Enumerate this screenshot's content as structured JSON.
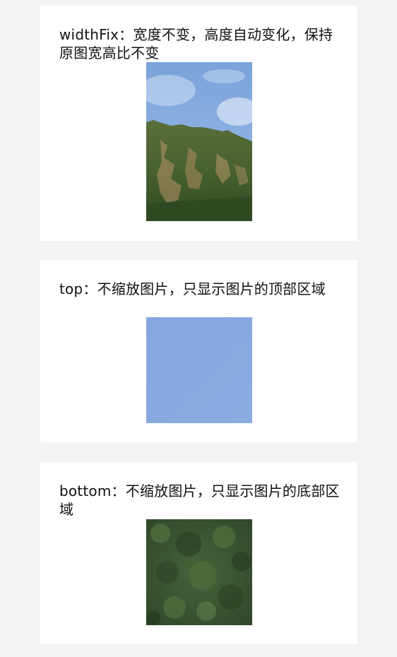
{
  "cards": [
    {
      "mode": "widthFix",
      "description": "widthFix：宽度不变，高度自动变化，保持原图宽高比不变"
    },
    {
      "mode": "top",
      "description": "top：不缩放图片，只显示图片的顶部区域"
    },
    {
      "mode": "bottom",
      "description": "bottom：不缩放图片，只显示图片的底部区域"
    }
  ],
  "colors": {
    "page_background": "#f3f3f3",
    "card_background": "#ffffff",
    "text": "#111111",
    "sky": "#86a8de",
    "forest": "#3d5a2c"
  }
}
